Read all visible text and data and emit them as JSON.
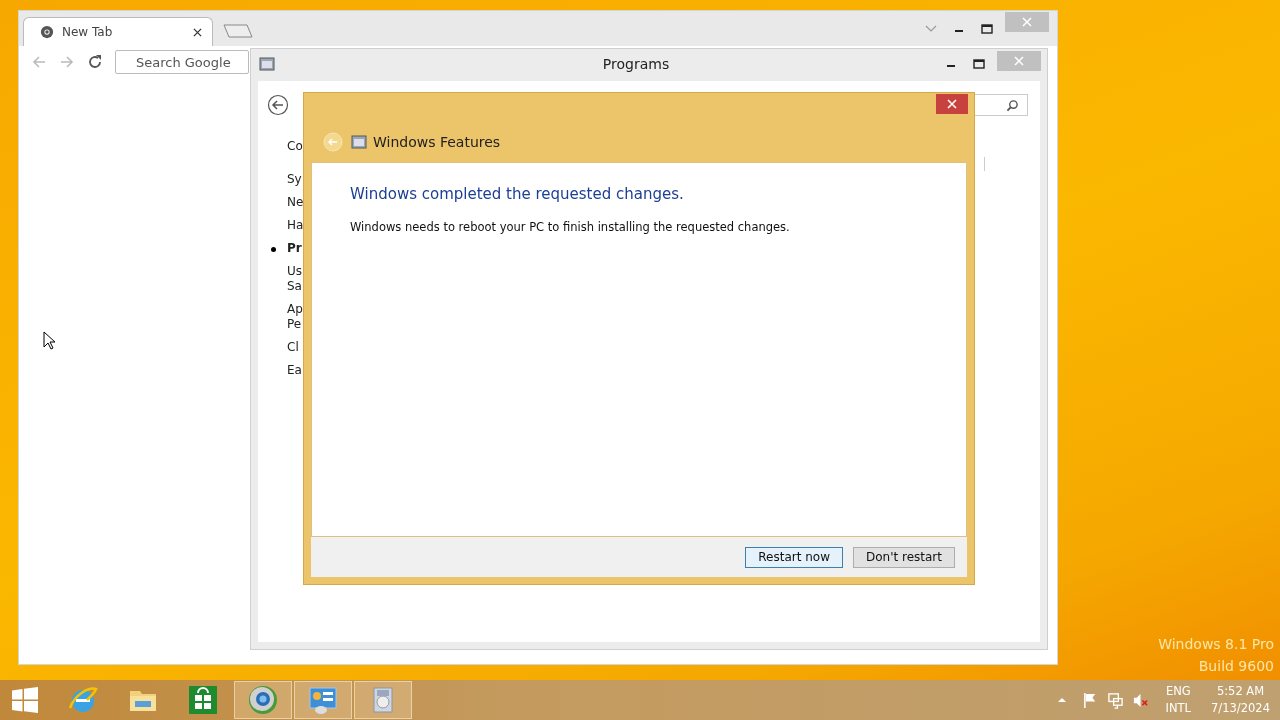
{
  "desktop": {
    "edition": "Windows 8.1 Pro",
    "build": "Build 9600"
  },
  "browser": {
    "tabs": [
      {
        "label": "New Tab",
        "selected": true
      }
    ],
    "omnibox": {
      "placeholder": "Search Google"
    }
  },
  "control_panel": {
    "title": "Programs",
    "nav": [
      {
        "lines": [
          "Co"
        ],
        "selected": false
      },
      {
        "lines": [
          "Sy"
        ],
        "selected": false
      },
      {
        "lines": [
          "Ne"
        ],
        "selected": false
      },
      {
        "lines": [
          "Ha"
        ],
        "selected": false
      },
      {
        "lines": [
          "Pr"
        ],
        "selected": true
      },
      {
        "lines": [
          "Us",
          "Sa"
        ],
        "selected": false
      },
      {
        "lines": [
          "Ap",
          "Pe"
        ],
        "selected": false
      },
      {
        "lines": [
          "Cl"
        ],
        "selected": false
      },
      {
        "lines": [
          "Ea"
        ],
        "selected": false
      }
    ]
  },
  "dialog": {
    "title": "Windows Features",
    "heading": "Windows completed the requested changes.",
    "message": "Windows needs to reboot your PC to finish installing the requested changes.",
    "buttons": [
      {
        "label": "Restart now",
        "selected": true
      },
      {
        "label": "Don't restart",
        "selected": false
      }
    ]
  },
  "taskbar": {
    "apps": [
      {
        "kind": "browser-e",
        "running": false
      },
      {
        "kind": "folder",
        "running": false
      },
      {
        "kind": "store",
        "running": false
      },
      {
        "kind": "globe",
        "running": true
      },
      {
        "kind": "panel",
        "running": true
      },
      {
        "kind": "installer",
        "running": true
      }
    ],
    "tray": {
      "language": "ENG",
      "layout": "INTL",
      "time": "5:52 AM",
      "date": "7/13/2024"
    }
  }
}
